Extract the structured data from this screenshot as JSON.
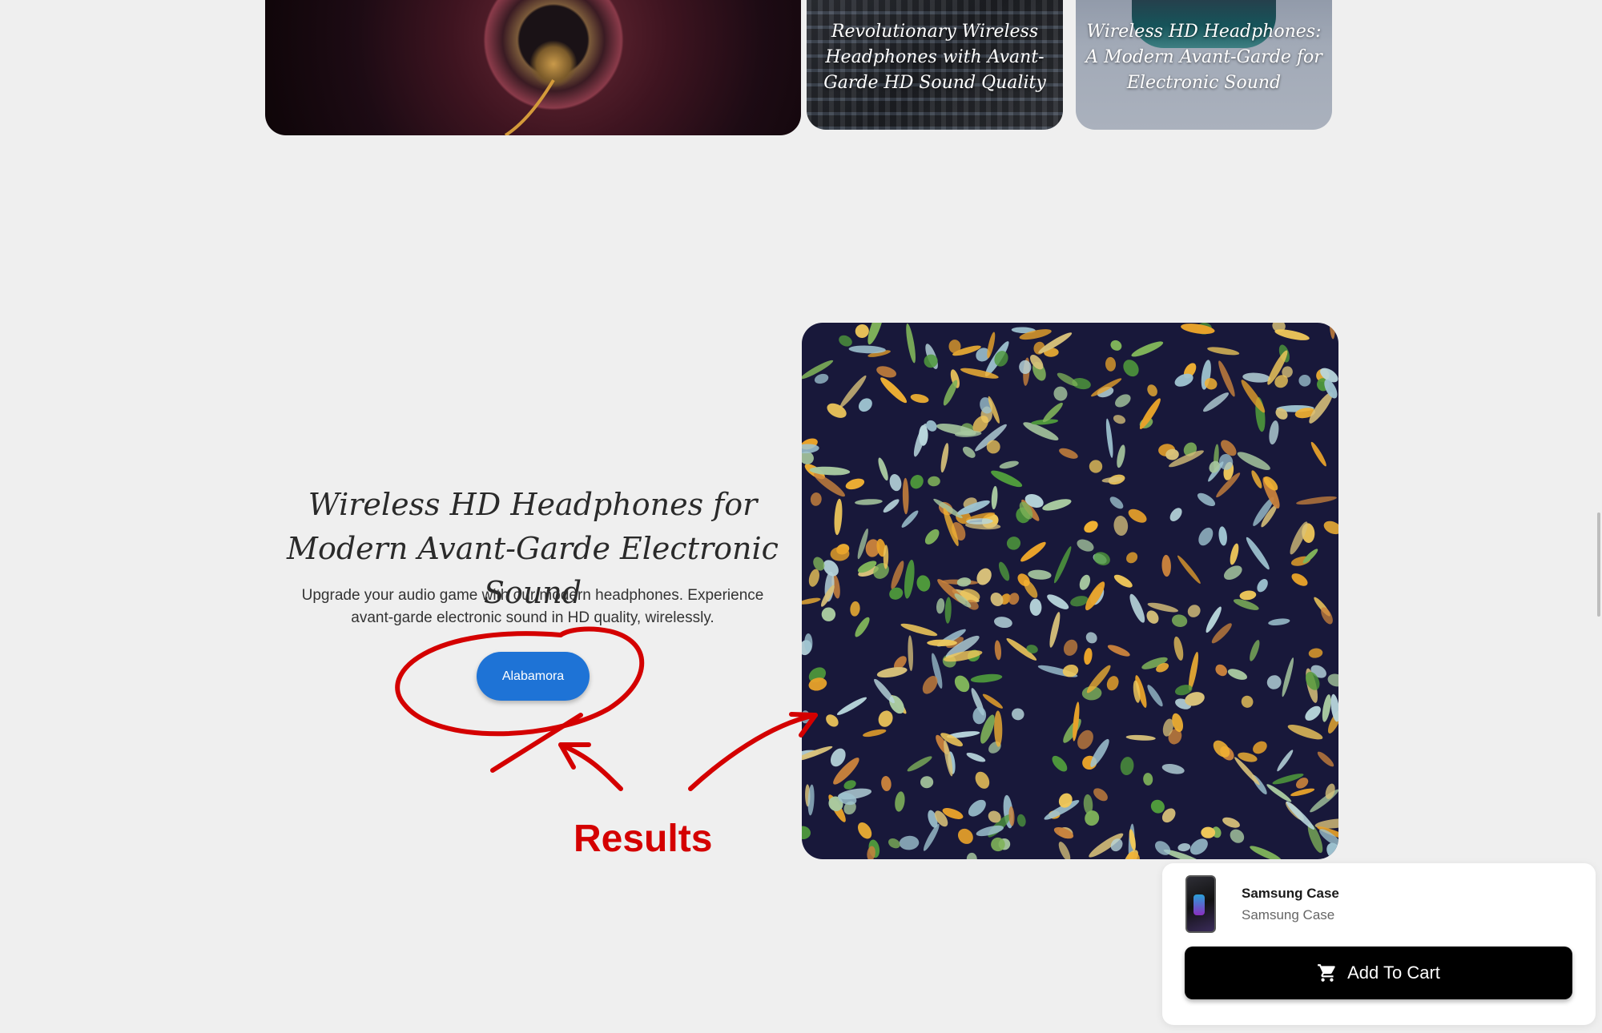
{
  "gallery": {
    "cards": [
      {
        "title": ""
      },
      {
        "title": "Revolutionary Wireless Headphones with Avant-Garde HD Sound Quality"
      },
      {
        "title": "Wireless HD Headphones: A Modern Avant-Garde for Electronic Sound"
      }
    ]
  },
  "hero": {
    "title": "Wireless HD Headphones for Modern Avant-Garde Electronic Sound",
    "description": "Upgrade your audio game with our modern headphones. Experience avant-garde electronic sound in HD quality, wirelessly.",
    "button_label": "Alabamora"
  },
  "annotation": {
    "label": "Results",
    "color": "#d40000"
  },
  "cart_popup": {
    "product_name": "Samsung Case",
    "product_subtitle": "Samsung Case",
    "add_button_label": "Add To Cart",
    "button_icon": "cart-icon"
  },
  "colors": {
    "background": "#efefef",
    "cta": "#1e73d6",
    "add_button": "#000000"
  }
}
